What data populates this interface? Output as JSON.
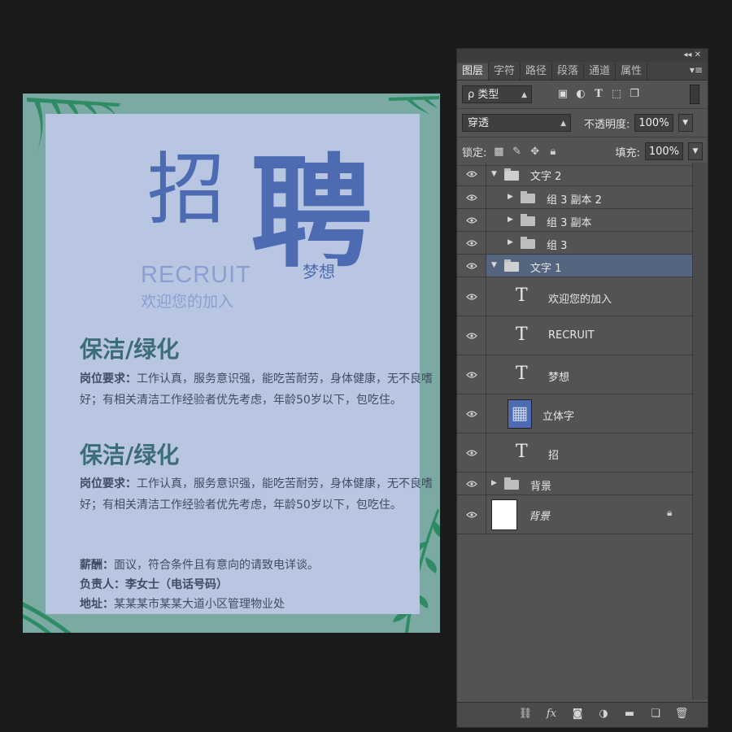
{
  "poster": {
    "title_char1": "招",
    "title_char2": "聘",
    "dream": "梦想",
    "recruit": "RECRUIT",
    "welcome": "欢迎您的加入",
    "section1_title": "保洁/绿化",
    "section1_label": "岗位要求：",
    "section1_text": "工作认真，服务意识强，能吃苦耐劳，身体健康，无不良嗜好；有相关清洁工作经验者优先考虑，年龄50岁以下，包吃住。",
    "section2_title": "保洁/绿化",
    "section2_label": "岗位要求：",
    "section2_text": "工作认真，服务意识强，能吃苦耐劳，身体健康，无不良嗜好；有相关清洁工作经验者优先考虑，年龄50岁以下，包吃住。",
    "salary_label": "薪酬：",
    "salary_text": "面议，符合条件且有意向的请致电详谈。",
    "contact_label": "负责人：李女士（电话号码）",
    "address_label": "地址：",
    "address_text": "某某某市某某大道小区管理物业处",
    "colors": {
      "frame": "#7ba9a4",
      "paper": "#b9c6e1",
      "title": "#4d6bb3",
      "section": "#3c6d76"
    }
  },
  "panel": {
    "collapse_glyph": "◂◂  ✕",
    "menu_glyph": "▾≡",
    "tabs": [
      {
        "label": "图层",
        "active": true
      },
      {
        "label": "字符"
      },
      {
        "label": "路径"
      },
      {
        "label": "段落"
      },
      {
        "label": "通道"
      },
      {
        "label": "属性"
      }
    ],
    "filter": {
      "label": "ρ 类型",
      "icons": [
        "image-filter-icon",
        "adjustment-filter-icon",
        "type-filter-icon",
        "shape-filter-icon",
        "smart-object-filter-icon"
      ]
    },
    "blend_mode": "穿透",
    "opacity_label": "不透明度:",
    "opacity_value": "100%",
    "lock_label": "锁定:",
    "fill_label": "填充:",
    "fill_value": "100%",
    "layers": [
      {
        "name": "文字 2",
        "type": "group-open"
      },
      {
        "name": "组 3 副本 2",
        "type": "group-closed"
      },
      {
        "name": "组 3 副本",
        "type": "group-closed"
      },
      {
        "name": "组 3",
        "type": "group-closed"
      },
      {
        "name": "文字 1",
        "type": "group-open",
        "selected": true
      },
      {
        "name": "欢迎您的加入",
        "type": "text"
      },
      {
        "name": "RECRUIT",
        "type": "text"
      },
      {
        "name": "梦想",
        "type": "text"
      },
      {
        "name": "立体字",
        "type": "smart-object"
      },
      {
        "name": "招",
        "type": "text"
      },
      {
        "name": "背景",
        "type": "group-closed"
      },
      {
        "name": "背景",
        "type": "background-locked"
      }
    ],
    "bottom_icons": [
      "link-layers-icon",
      "fx-icon",
      "add-mask-icon",
      "adjustment-layer-icon",
      "new-group-icon",
      "new-layer-icon",
      "trash-icon"
    ]
  }
}
